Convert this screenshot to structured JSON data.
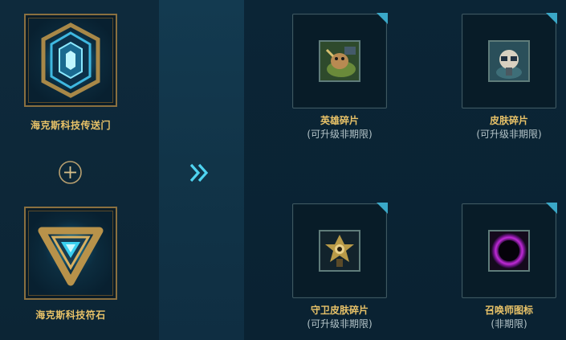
{
  "inputs": {
    "top": {
      "label": "海克斯科技传送门",
      "icon": "hextech-gate-icon"
    },
    "bottom": {
      "label": "海克斯科技符石",
      "icon": "hextech-rune-icon"
    },
    "combine_icon": "plus-circle-icon",
    "transform_icon": "double-chevron-right-icon"
  },
  "outputs": [
    {
      "name": "英雄碎片",
      "note": "(可升级非期限)",
      "icon": "champion-shard-icon"
    },
    {
      "name": "皮肤碎片",
      "note": "(可升级非期限)",
      "icon": "skin-shard-icon"
    },
    {
      "name": "守卫皮肤碎片",
      "note": "(可升级非期限)",
      "icon": "ward-skin-shard-icon"
    },
    {
      "name": "召唤师图标",
      "note": "(非期限)",
      "icon": "summoner-icon-icon"
    }
  ],
  "colors": {
    "gold": "#e8c268",
    "frame_gold": "#8a7040",
    "accent_cyan": "#4fd3f0",
    "muted_text": "#b4c4c8"
  }
}
